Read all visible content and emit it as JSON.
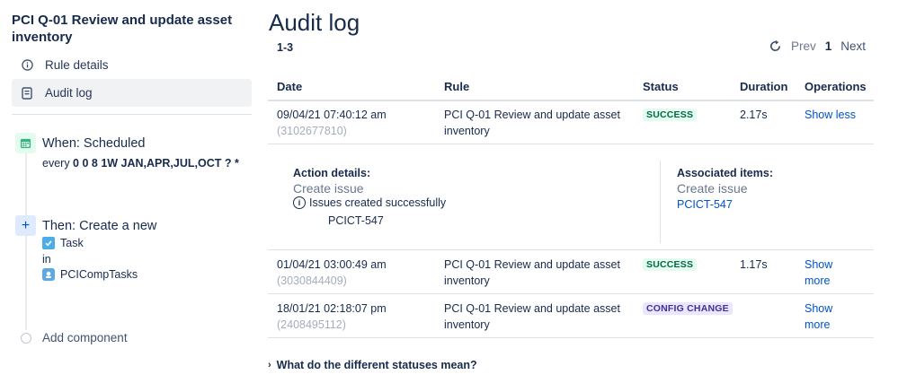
{
  "sidebar": {
    "rule_title": "PCI Q-01 Review and update asset inventory",
    "nav": [
      {
        "label": "Rule details",
        "icon": "info-icon"
      },
      {
        "label": "Audit log",
        "icon": "document-icon"
      }
    ],
    "trigger": {
      "title": "When: Scheduled",
      "prefix": "every ",
      "cron": "0 0 8 1W JAN,APR,JUL,OCT ? *",
      "icon": "calendar-icon"
    },
    "action": {
      "title": "Then: Create a new",
      "issue_type": "Task",
      "in_label": "in",
      "project": "PCICompTasks",
      "icon": "plus-icon"
    },
    "add_component": "Add component"
  },
  "main": {
    "title": "Audit log",
    "range": "1-3",
    "pager": {
      "prev": "Prev",
      "current": "1",
      "next": "Next"
    },
    "columns": [
      "Date",
      "Rule",
      "Status",
      "Duration",
      "Operations"
    ],
    "rows": [
      {
        "date": "09/04/21 07:40:12 am",
        "id": "(3102677810)",
        "rule": "PCI Q-01 Review and update asset inventory",
        "status": "SUCCESS",
        "duration": "2.17s",
        "operation": "Show less"
      },
      {
        "date": "01/04/21 03:00:49 am",
        "id": "(3030844409)",
        "rule": "PCI Q-01 Review and update asset inventory",
        "status": "SUCCESS",
        "duration": "1.17s",
        "operation": "Show more"
      },
      {
        "date": "18/01/21 02:18:07 pm",
        "id": "(2408495112)",
        "rule": "PCI Q-01 Review and update asset inventory",
        "status": "CONFIG CHANGE",
        "duration": "",
        "operation": "Show more"
      }
    ],
    "detail": {
      "action_label": "Action details:",
      "action_value": "Create issue",
      "action_note": "Issues created successfully",
      "action_key": "PCICT-547",
      "assoc_label": "Associated items:",
      "assoc_value": "Create issue",
      "assoc_link": "PCICT-547"
    },
    "faq": "What do the different statuses mean?"
  },
  "colors": {
    "link": "#0052cc",
    "success_bg": "#e3fcef",
    "success_fg": "#006644",
    "config_bg": "#eae6ff",
    "config_fg": "#403294"
  }
}
